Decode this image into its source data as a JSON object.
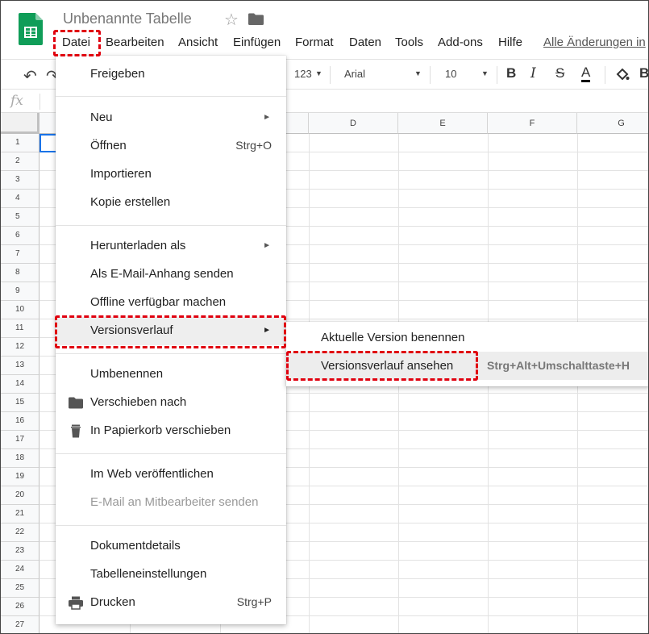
{
  "app": {
    "title": "Unbenannte Tabelle",
    "save_status": "Alle Änderungen in"
  },
  "menubar": [
    "Datei",
    "Bearbeiten",
    "Ansicht",
    "Einfügen",
    "Format",
    "Daten",
    "Tools",
    "Add-ons",
    "Hilfe"
  ],
  "toolbar": {
    "number_format": "123",
    "font": "Arial",
    "font_size": "10",
    "bold": "B",
    "italic": "I",
    "strike": "S",
    "text_color": "A"
  },
  "formula_bar": {
    "label": "fx",
    "value": ""
  },
  "grid": {
    "visible_columns": [
      "D",
      "E",
      "F",
      "G"
    ],
    "rows": [
      "1",
      "2",
      "3",
      "4",
      "5",
      "6",
      "7",
      "8",
      "9",
      "10",
      "11",
      "12",
      "13",
      "14",
      "15",
      "16",
      "17",
      "18",
      "19",
      "20",
      "21",
      "22",
      "23",
      "24",
      "25",
      "26",
      "27"
    ]
  },
  "file_menu": {
    "items": [
      {
        "label": "Freigeben"
      },
      {
        "label": "Neu",
        "submenu": true
      },
      {
        "label": "Öffnen",
        "shortcut": "Strg+O"
      },
      {
        "label": "Importieren"
      },
      {
        "label": "Kopie erstellen"
      },
      {
        "label": "Herunterladen als",
        "submenu": true
      },
      {
        "label": "Als E-Mail-Anhang senden"
      },
      {
        "label": "Offline verfügbar machen"
      },
      {
        "label": "Versionsverlauf",
        "submenu": true
      },
      {
        "label": "Umbenennen"
      },
      {
        "label": "Verschieben nach",
        "icon": "folder-icon"
      },
      {
        "label": "In Papierkorb verschieben",
        "icon": "trash-icon"
      },
      {
        "label": "Im Web veröffentlichen"
      },
      {
        "label": "E-Mail an Mitbearbeiter senden",
        "disabled": true
      },
      {
        "label": "Dokumentdetails"
      },
      {
        "label": "Tabelleneinstellungen"
      },
      {
        "label": "Drucken",
        "icon": "print-icon",
        "shortcut": "Strg+P"
      }
    ]
  },
  "version_submenu": {
    "items": [
      {
        "label": "Aktuelle Version benennen"
      },
      {
        "label": "Versionsverlauf ansehen",
        "shortcut": "Strg+Alt+Umschalttaste+H"
      }
    ]
  },
  "colors": {
    "highlight": "#e0000f",
    "sheets_green": "#0f9d58",
    "selection_blue": "#1a73e8"
  }
}
